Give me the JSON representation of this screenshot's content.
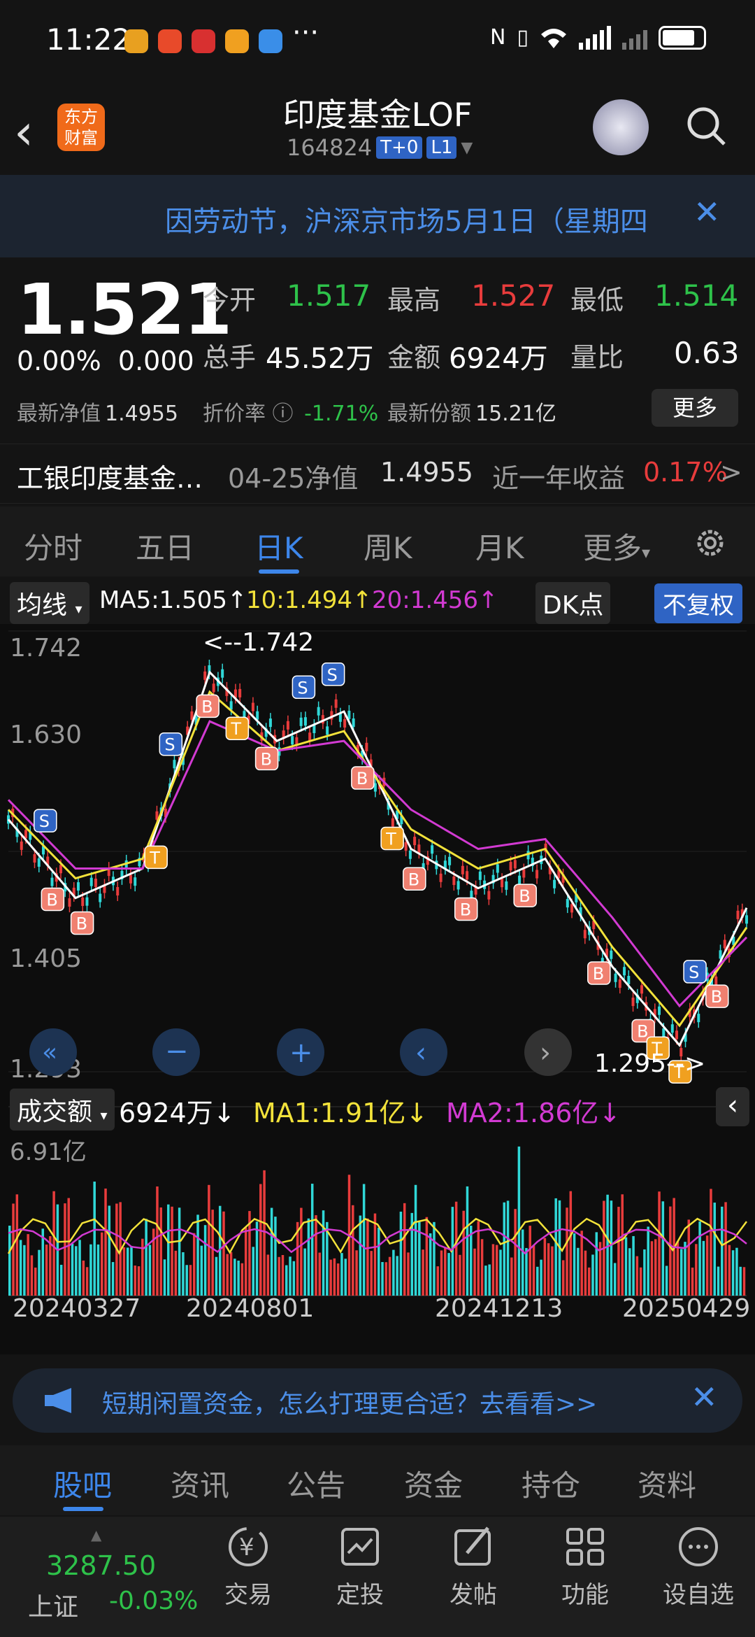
{
  "status": {
    "time": "11:22"
  },
  "header": {
    "title": "印度基金LOF",
    "code": "164824",
    "tag1": "T+0",
    "tag2": "L1"
  },
  "notice": {
    "text": "因劳动节，沪深京市场5月1日（星期四"
  },
  "quote": {
    "price": "1.521",
    "change_pct": "0.00%",
    "change": "0.000",
    "open_label": "今开",
    "open": "1.517",
    "high_label": "最高",
    "high": "1.527",
    "low_label": "最低",
    "low": "1.514",
    "vol_label": "总手",
    "vol": "45.52万",
    "amt_label": "金额",
    "amt": "6924万",
    "ratio_label": "量比",
    "ratio": "0.63",
    "nav_label": "最新净值",
    "nav": "1.4955",
    "disc_label": "折价率",
    "disc": "-1.71%",
    "share_label": "最新份额",
    "share": "15.21亿",
    "more": "更多"
  },
  "fundrow": {
    "name": "工银印度基金…",
    "date": "04-25净值",
    "nav": "1.4955",
    "yr_label": "近一年收益",
    "yr": "0.17%"
  },
  "tabs": [
    "分时",
    "五日",
    "日K",
    "周K",
    "月K",
    "更多"
  ],
  "indicator": {
    "ma_select": "均线",
    "ma5": "MA5:1.505↑",
    "ma10": "10:1.494↑",
    "ma20": "20:1.456↑",
    "dk": "DK点",
    "fq": "不复权"
  },
  "chart_data": {
    "type": "line",
    "title": "日K",
    "price_max_label": "1.742",
    "price_mid1": "1.630",
    "price_mid2": "1.405",
    "price_min_label": "1.293",
    "high_mark": "<--1.742",
    "low_mark": "1.295-->",
    "x": [
      "20240327",
      "20240801",
      "20241213",
      "20250429"
    ],
    "volume_max_label": "6.91亿",
    "series": [
      {
        "name": "MA5",
        "values": [
          1.55,
          1.47,
          1.5,
          1.7,
          1.63,
          1.66,
          1.52,
          1.48,
          1.51,
          1.4,
          1.32,
          1.46
        ]
      },
      {
        "name": "10",
        "values": [
          1.56,
          1.49,
          1.51,
          1.68,
          1.62,
          1.64,
          1.54,
          1.5,
          1.52,
          1.42,
          1.34,
          1.44
        ]
      },
      {
        "name": "20",
        "values": [
          1.57,
          1.5,
          1.5,
          1.65,
          1.62,
          1.63,
          1.56,
          1.52,
          1.53,
          1.45,
          1.36,
          1.43
        ]
      }
    ]
  },
  "volume": {
    "select": "成交额",
    "value": "6924万↓",
    "ma1": "MA1:1.91亿↓",
    "ma2": "MA2:1.86亿↓"
  },
  "ad": {
    "text": "短期闲置资金，怎么打理更合适？去看看>>"
  },
  "subtabs": [
    "股吧",
    "资讯",
    "公告",
    "资金",
    "持仓",
    "资料"
  ],
  "bottom": {
    "index_val": "3287.50",
    "index_name": "上证",
    "index_chg": "-0.03%",
    "nav": [
      "交易",
      "定投",
      "发帖",
      "功能",
      "设自选"
    ]
  }
}
